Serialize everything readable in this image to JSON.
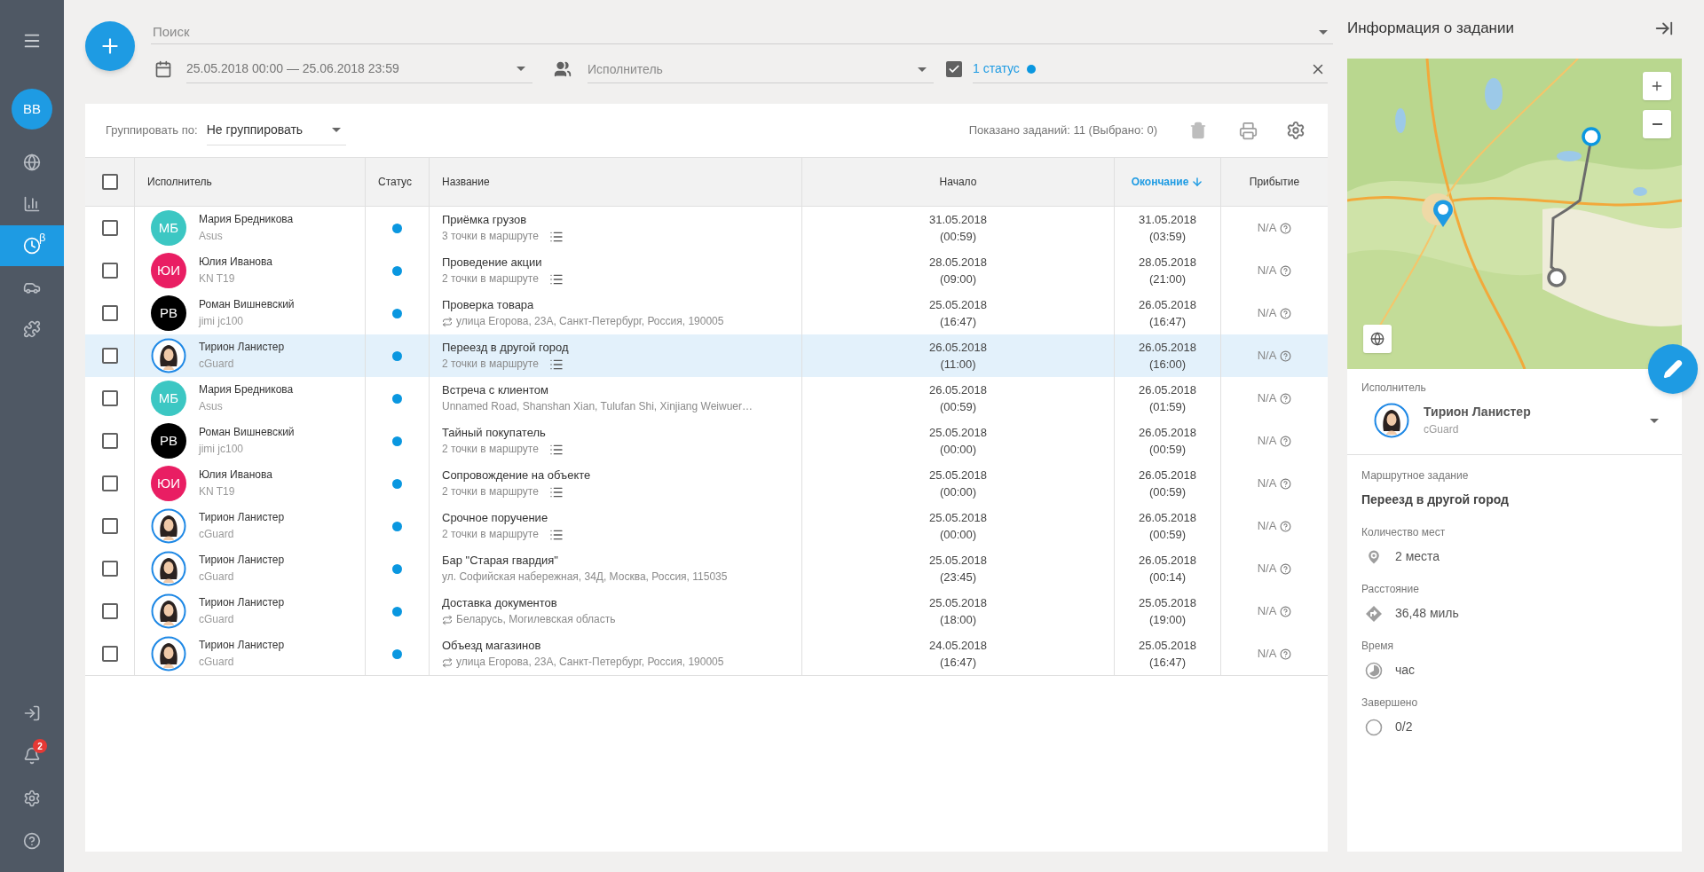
{
  "sidebar": {
    "avatar": "BB",
    "items": [
      {
        "kind": "globe",
        "selected": false
      },
      {
        "kind": "chart",
        "selected": false
      },
      {
        "kind": "tasks",
        "selected": true,
        "badge": "β"
      },
      {
        "kind": "car",
        "selected": false
      },
      {
        "kind": "puzzle",
        "selected": false
      }
    ],
    "bottom_items": [
      {
        "kind": "login"
      },
      {
        "kind": "bell",
        "badge": "2"
      },
      {
        "kind": "settings"
      },
      {
        "kind": "help"
      }
    ]
  },
  "filters": {
    "search": {
      "placeholder": "Поиск"
    },
    "date_range": {
      "value": "25.05.2018 00:00 — 25.06.2018 23:59"
    },
    "executor": {
      "placeholder": "Исполнитель"
    },
    "status": {
      "checked": true,
      "value": "1 статус",
      "color": "#0a97e0"
    }
  },
  "toolbar": {
    "group_label": "Группировать по:",
    "group_value": "Не группировать",
    "summary": "Показано заданий: 11 (Выбрано: 0)"
  },
  "table": {
    "select_all": {
      "checked": false
    },
    "columns": [
      {
        "label": "Исполнитель",
        "sorted": false
      },
      {
        "label": "Статус",
        "sorted": false
      },
      {
        "label": "Название",
        "sorted": false
      },
      {
        "label": "Начало",
        "sorted": false
      },
      {
        "label": "Окончание",
        "sorted": true
      },
      {
        "label": "Прибытие",
        "sorted": false
      }
    ],
    "rows": [
      {
        "checked": false,
        "selected": false,
        "executor": {
          "name": "Мария Бредникова",
          "device": "Asus",
          "avatar": {
            "kind": "initials",
            "text": "МБ",
            "color": "#3cc7c3"
          }
        },
        "title": "Приёмка грузов",
        "detail": {
          "kind": "points",
          "text": "3 точки в маршруте"
        },
        "start": [
          "31.05.2018",
          "(00:59)"
        ],
        "end": [
          "31.05.2018",
          "(03:59)"
        ],
        "arrival": "N/A"
      },
      {
        "checked": false,
        "selected": false,
        "executor": {
          "name": "Юлия Иванова",
          "device": "KN T19",
          "avatar": {
            "kind": "initials",
            "text": "ЮИ",
            "color": "#e91e63"
          }
        },
        "title": "Проведение акции",
        "detail": {
          "kind": "points",
          "text": "2 точки в маршруте"
        },
        "start": [
          "28.05.2018",
          "(09:00)"
        ],
        "end": [
          "28.05.2018",
          "(21:00)"
        ],
        "arrival": "N/A"
      },
      {
        "checked": false,
        "selected": false,
        "executor": {
          "name": "Роман Вишневский",
          "device": "jimi jc100",
          "avatar": {
            "kind": "initials",
            "text": "РВ",
            "color": "#000000"
          }
        },
        "title": "Проверка товара",
        "detail": {
          "kind": "repeat",
          "text": "улица Егорова, 23А, Санкт-Петербург, Россия, 190005"
        },
        "start": [
          "25.05.2018",
          "(16:47)"
        ],
        "end": [
          "26.05.2018",
          "(16:47)"
        ],
        "arrival": "N/A"
      },
      {
        "checked": false,
        "selected": true,
        "executor": {
          "name": "Тирион Ланистер",
          "device": "cGuard"
        },
        "title": "Переезд в другой город",
        "detail": {
          "kind": "points",
          "text": "2 точки в маршруте"
        },
        "start": [
          "26.05.2018",
          "(11:00)"
        ],
        "end": [
          "26.05.2018",
          "(16:00)"
        ],
        "arrival": "N/A"
      },
      {
        "checked": false,
        "selected": false,
        "executor": {
          "name": "Мария Бредникова",
          "device": "Asus",
          "avatar": {
            "kind": "initials",
            "text": "МБ",
            "color": "#3cc7c3"
          }
        },
        "title": "Встреча с клиентом",
        "detail": {
          "kind": "plain",
          "text": "Unnamed Road, Shanshan Xian, Tulufan Shi, Xinjiang Weiwuer…"
        },
        "start": [
          "26.05.2018",
          "(00:59)"
        ],
        "end": [
          "26.05.2018",
          "(01:59)"
        ],
        "arrival": "N/A"
      },
      {
        "checked": false,
        "selected": false,
        "executor": {
          "name": "Роман Вишневский",
          "device": "jimi jc100",
          "avatar": {
            "kind": "initials",
            "text": "РВ",
            "color": "#000000"
          }
        },
        "title": "Тайный покупатель",
        "detail": {
          "kind": "points",
          "text": "2 точки в маршруте"
        },
        "start": [
          "25.05.2018",
          "(00:00)"
        ],
        "end": [
          "26.05.2018",
          "(00:59)"
        ],
        "arrival": "N/A"
      },
      {
        "checked": false,
        "selected": false,
        "executor": {
          "name": "Юлия Иванова",
          "device": "KN T19",
          "avatar": {
            "kind": "initials",
            "text": "ЮИ",
            "color": "#e91e63"
          }
        },
        "title": "Сопровождение на объекте",
        "detail": {
          "kind": "points",
          "text": "2 точки в маршруте"
        },
        "start": [
          "25.05.2018",
          "(00:00)"
        ],
        "end": [
          "26.05.2018",
          "(00:59)"
        ],
        "arrival": "N/A"
      },
      {
        "checked": false,
        "selected": false,
        "executor": {
          "name": "Тирион Ланистер",
          "device": "cGuard"
        },
        "title": "Срочное поручение",
        "detail": {
          "kind": "points",
          "text": "2 точки в маршруте"
        },
        "start": [
          "25.05.2018",
          "(00:00)"
        ],
        "end": [
          "26.05.2018",
          "(00:59)"
        ],
        "arrival": "N/A"
      },
      {
        "checked": false,
        "selected": false,
        "executor": {
          "name": "Тирион Ланистер",
          "device": "cGuard"
        },
        "title": "Бар \"Старая гвардия\"",
        "detail": {
          "kind": "plain",
          "text": "ул. Софийская набережная, 34Д, Москва, Россия, 115035"
        },
        "start": [
          "25.05.2018",
          "(23:45)"
        ],
        "end": [
          "26.05.2018",
          "(00:14)"
        ],
        "arrival": "N/A"
      },
      {
        "checked": false,
        "selected": false,
        "executor": {
          "name": "Тирион Ланистер",
          "device": "cGuard"
        },
        "title": "Доставка документов",
        "detail": {
          "kind": "repeat",
          "text": "Беларусь, Могилевская область"
        },
        "start": [
          "25.05.2018",
          "(18:00)"
        ],
        "end": [
          "25.05.2018",
          "(19:00)"
        ],
        "arrival": "N/A"
      },
      {
        "checked": false,
        "selected": false,
        "executor": {
          "name": "Тирион Ланистер",
          "device": "cGuard"
        },
        "title": "Объезд магазинов",
        "detail": {
          "kind": "repeat",
          "text": "улица Егорова, 23А, Санкт-Петербург, Россия, 190005"
        },
        "start": [
          "24.05.2018",
          "(16:47)"
        ],
        "end": [
          "25.05.2018",
          "(16:47)"
        ],
        "arrival": "N/A"
      }
    ]
  },
  "panel": {
    "title": "Информация о задании",
    "executor_label": "Исполнитель",
    "executor": {
      "name": "Тирион Ланистер",
      "device": "cGuard"
    },
    "fields": [
      {
        "kind": "title",
        "label": "Маршрутное задание",
        "value": "Переезд в другой город"
      },
      {
        "kind": "places",
        "label": "Количество мест",
        "value": "2 места"
      },
      {
        "kind": "distance",
        "label": "Расстояние",
        "value": "36,48 миль"
      },
      {
        "kind": "time",
        "label": "Время",
        "value": "час"
      },
      {
        "kind": "done",
        "label": "Завершено",
        "value": "0/2"
      }
    ]
  }
}
